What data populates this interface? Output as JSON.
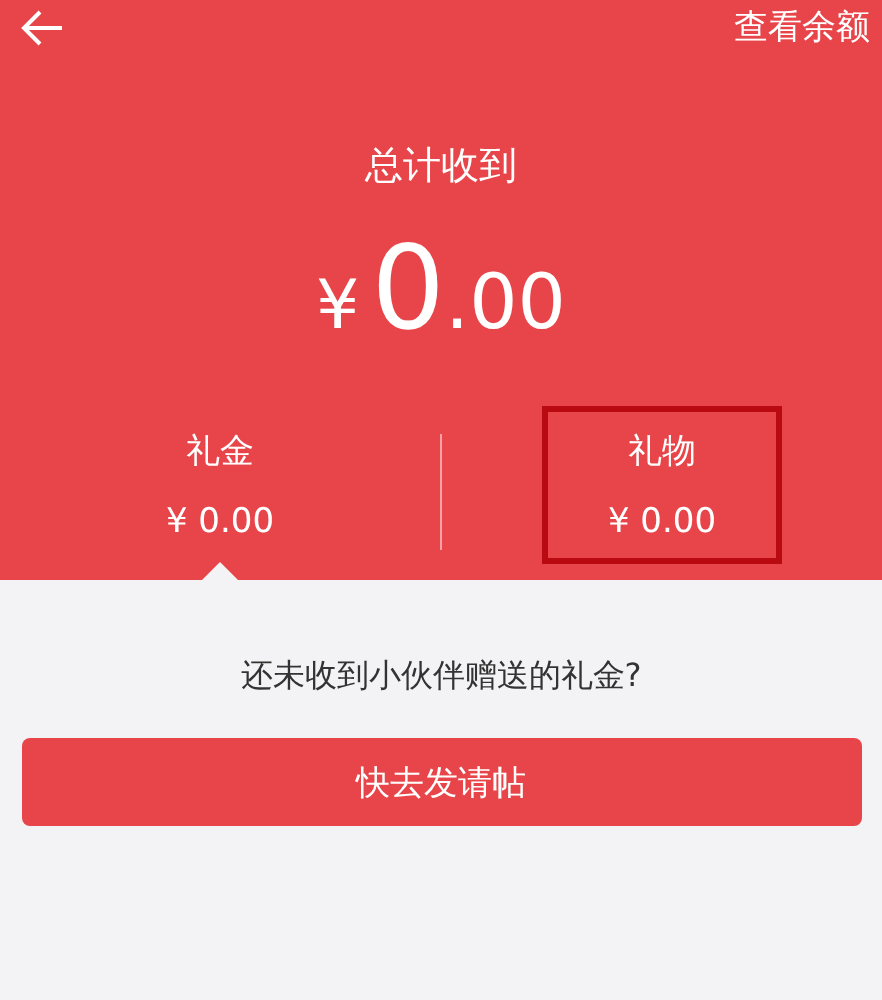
{
  "header": {
    "action": "查看余额"
  },
  "total": {
    "label": "总计收到",
    "currency": "¥",
    "integer": "0",
    "decimals": ".00"
  },
  "categories": [
    {
      "label": "礼金",
      "amount": "¥ 0.00",
      "selected": true,
      "highlighted": false
    },
    {
      "label": "礼物",
      "amount": "¥ 0.00",
      "selected": false,
      "highlighted": true
    }
  ],
  "empty_message": "还未收到小伙伴赠送的礼金?",
  "button": "快去发请帖"
}
